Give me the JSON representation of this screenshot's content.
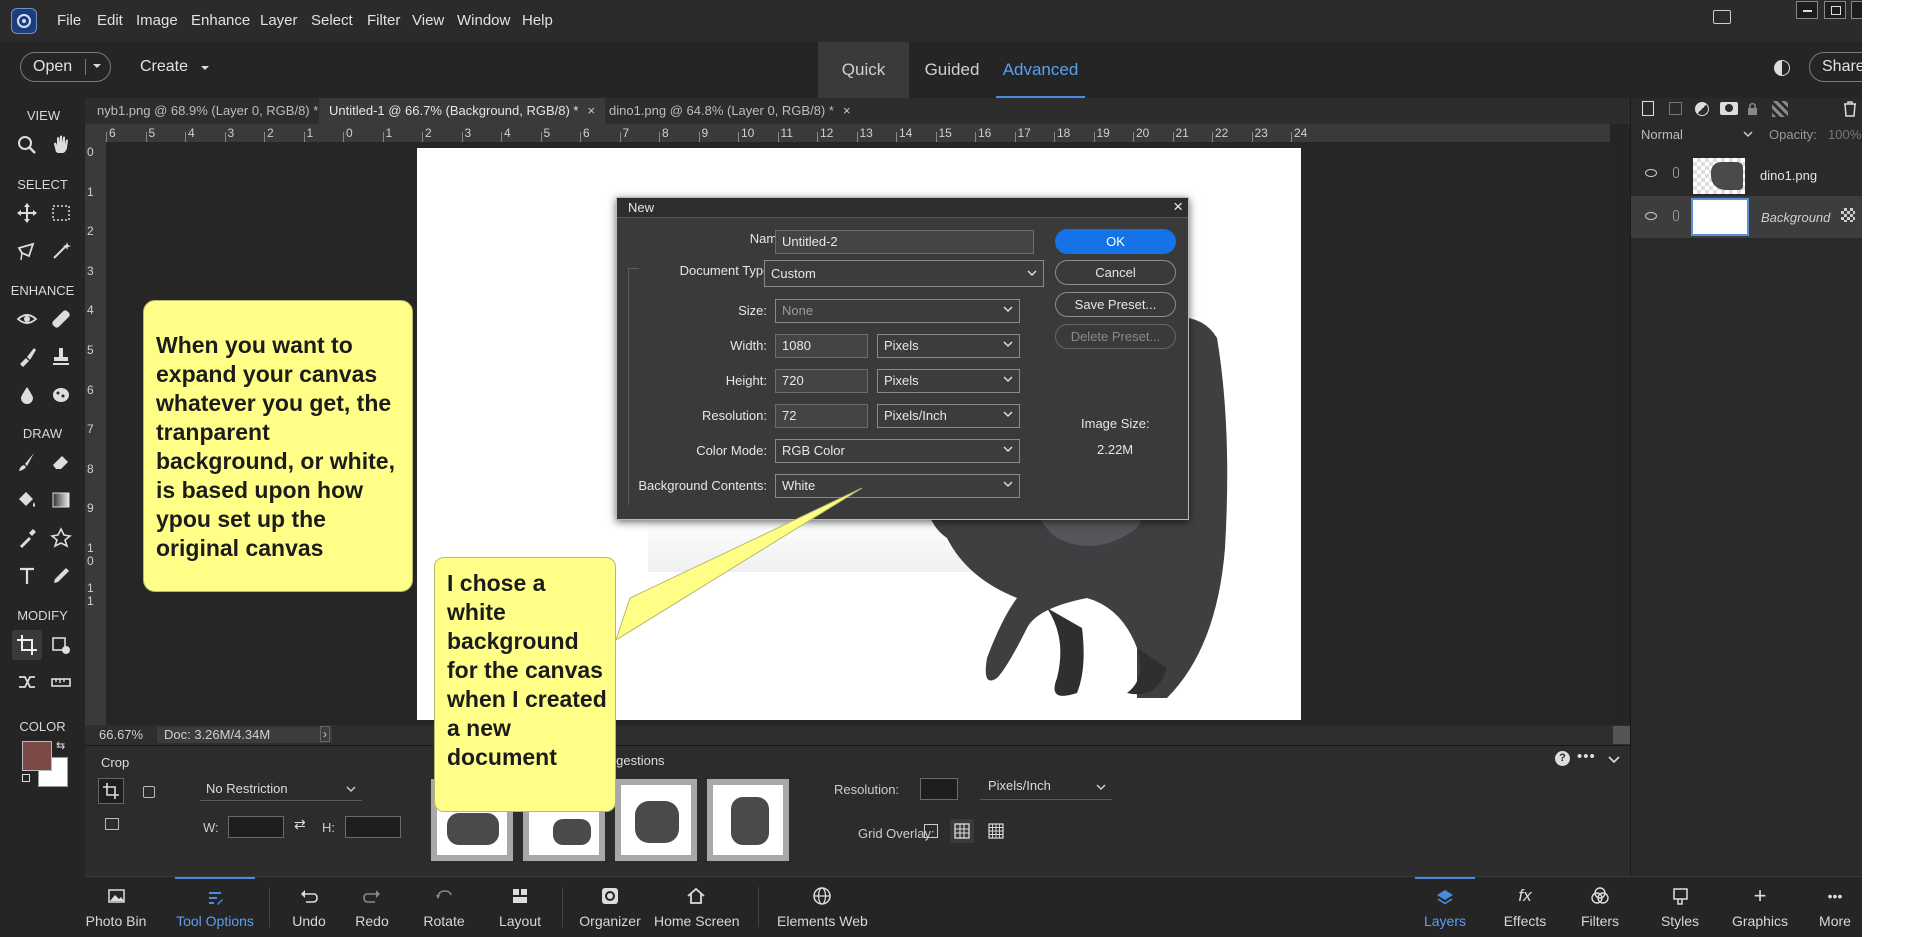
{
  "menu": {
    "items": [
      "File",
      "Edit",
      "Image",
      "Enhance",
      "Layer",
      "Select",
      "Filter",
      "View",
      "Window",
      "Help"
    ]
  },
  "modebar": {
    "open_label": "Open",
    "create_label": "Create",
    "modes": [
      "Quick",
      "Guided",
      "Advanced"
    ],
    "active_mode": "Advanced",
    "share_label": "Share"
  },
  "toolbox": {
    "sections": {
      "view": "VIEW",
      "select": "SELECT",
      "enhance": "ENHANCE",
      "draw": "DRAW",
      "modify": "MODIFY",
      "color": "COLOR"
    },
    "foreground_color": "#7b4a47",
    "background_color": "#ffffff"
  },
  "doc_tabs": [
    "nyb1.png @ 68.9% (Layer 0, RGB/8) *",
    "Untitled-1 @ 66.7% (Background, RGB/8) *",
    "dino1.png @ 64.8% (Layer 0, RGB/8) *"
  ],
  "ruler": {
    "h": [
      "6",
      "5",
      "4",
      "3",
      "2",
      "1",
      "0",
      "1",
      "2",
      "3",
      "4",
      "5",
      "6",
      "7",
      "8",
      "9",
      "10",
      "11",
      "12",
      "13",
      "14",
      "15",
      "16",
      "17",
      "18",
      "19",
      "20",
      "21",
      "22",
      "23",
      "24"
    ],
    "v": [
      "0",
      "1",
      "2",
      "3",
      "4",
      "5",
      "6",
      "7",
      "8",
      "9",
      "1\n0",
      "1\n1"
    ]
  },
  "status": {
    "zoom": "66.67%",
    "doc": "Doc: 3.26M/4.34M"
  },
  "layers_panel": {
    "blend_mode": "Normal",
    "opacity_label": "Opacity:",
    "opacity_value": "100%",
    "layers": [
      {
        "name": "dino1.png"
      },
      {
        "name": "Background"
      }
    ]
  },
  "dialog": {
    "title": "New",
    "name_label": "Name:",
    "name_value": "Untitled-2",
    "doctype_label": "Document Type:",
    "doctype_value": "Custom",
    "size_label": "Size:",
    "size_value": "None",
    "width_label": "Width:",
    "width_value": "1080",
    "width_unit": "Pixels",
    "height_label": "Height:",
    "height_value": "720",
    "height_unit": "Pixels",
    "resolution_label": "Resolution:",
    "resolution_value": "72",
    "resolution_unit": "Pixels/Inch",
    "colormode_label": "Color Mode:",
    "colormode_value": "RGB Color",
    "bg_label": "Background Contents:",
    "bg_value": "White",
    "ok": "OK",
    "cancel": "Cancel",
    "save_preset": "Save Preset...",
    "delete_preset": "Delete Preset...",
    "image_size_label": "Image Size:",
    "image_size_value": "2.22M"
  },
  "callouts": {
    "left": "When you want  to expand your canvas whatever you get, the tranparent background, or white, is based upon how ypou set up the original canvas",
    "right": "I chose a white background for the canvas when I created a new document"
  },
  "tool_options": {
    "title": "Crop",
    "restriction": "No Restriction",
    "w_label": "W:",
    "h_label": "H:",
    "suggestions": "Suggestions",
    "resolution_label": "Resolution:",
    "resolution_unit": "Pixels/Inch",
    "grid_label": "Grid Overlay:"
  },
  "bottom_bar": {
    "left": [
      "Photo Bin",
      "Tool Options",
      "Undo",
      "Redo",
      "Rotate",
      "Layout",
      "Organizer",
      "Home Screen",
      "Elements Web"
    ],
    "right": [
      "Layers",
      "Effects",
      "Filters",
      "Styles",
      "Graphics",
      "More"
    ]
  }
}
